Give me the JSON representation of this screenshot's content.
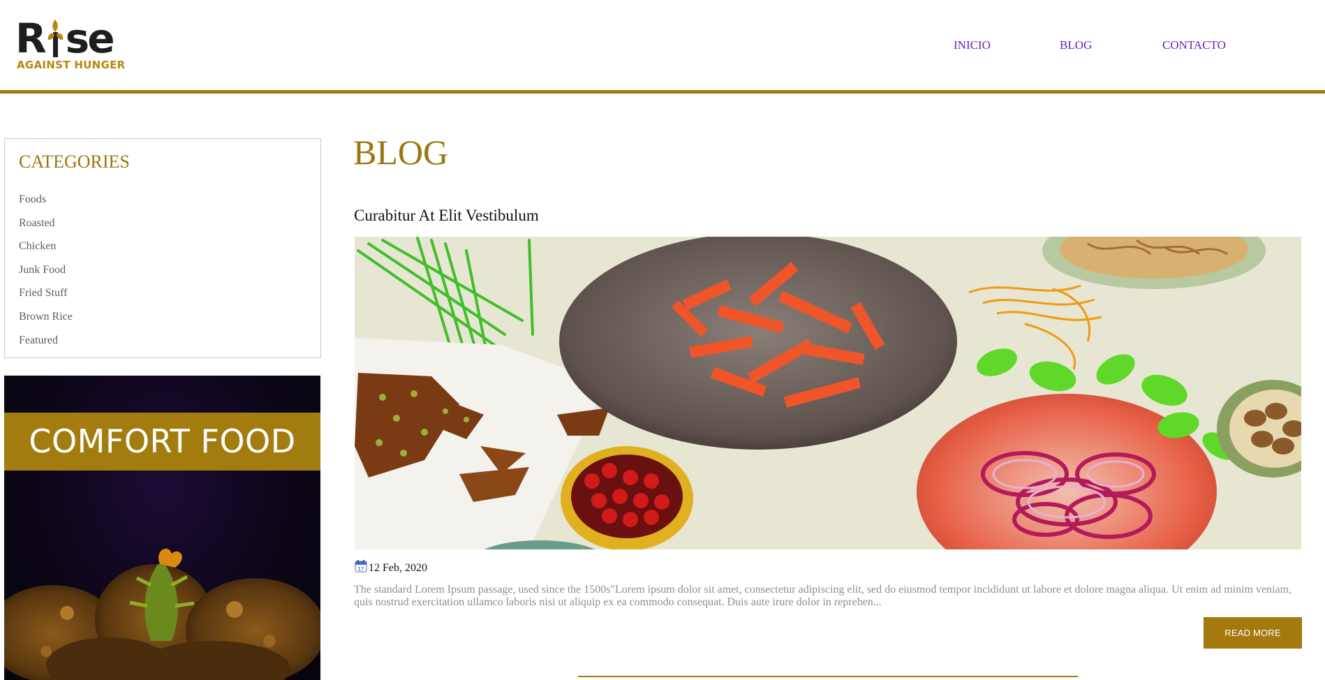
{
  "brand": {
    "logo_top": "Rise",
    "logo_bottom": "AGAINST HUNGER",
    "accent_color": "#a4790e"
  },
  "nav": {
    "items": [
      {
        "label": "INICIO"
      },
      {
        "label": "BLOG"
      },
      {
        "label": "CONTACTO"
      }
    ]
  },
  "sidebar": {
    "categories_title": "CATEGORIES",
    "categories": [
      "Foods",
      "Roasted",
      "Chicken",
      "Junk Food",
      "Fried Stuff",
      "Brown Rice",
      "Featured"
    ],
    "promo_text": "COMFORT FOOD"
  },
  "main": {
    "page_title": "BLOG",
    "post": {
      "title": "Curabitur At Elit Vestibulum",
      "date": "12 Feb, 2020",
      "date_icon": "calendar-icon",
      "excerpt": "The standard Lorem Ipsum passage, used since the 1500s\"Lorem ipsum dolor sit amet, consectetur adipiscing elit, sed do eiusmod tempor incididunt ut labore et dolore magna aliqua. Ut enim ad minim veniam, quis nostrud exercitation ullamco laboris nisi ut aliquip ex ea commodo consequat. Duis aute irure dolor in reprehen...",
      "read_more_label": "READ MORE"
    }
  }
}
